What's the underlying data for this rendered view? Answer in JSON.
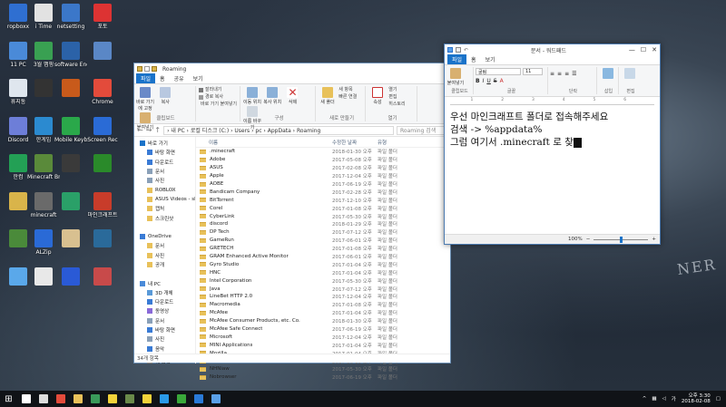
{
  "desktop": {
    "icons": [
      {
        "label": "ropboxx",
        "color": "#2f6fd1"
      },
      {
        "label": "i Time",
        "color": "#e2e2e2"
      },
      {
        "label": "netsetting",
        "color": "#3b77c9"
      },
      {
        "label": "포토",
        "color": "#d33"
      },
      {
        "label": "11 PC",
        "color": "#4a8ad8"
      },
      {
        "label": "3월 맵핑",
        "color": "#39a052"
      },
      {
        "label": "software Engine",
        "color": "#2b62a8"
      },
      {
        "label": "",
        "color": "#5a87c6"
      },
      {
        "label": "휴지통",
        "color": "#dfe6ee"
      },
      {
        "label": "",
        "color": "#333"
      },
      {
        "label": "",
        "color": "#c85a1b"
      },
      {
        "label": "Chrome",
        "color": "#e34b3b"
      },
      {
        "label": "Discord",
        "color": "#6d7ed8"
      },
      {
        "label": "한게임",
        "color": "#2b8ad0"
      },
      {
        "label": "Mobile Keyboard",
        "color": "#2aa84a"
      },
      {
        "label": "Screen Rec",
        "color": "#2a6bd6"
      },
      {
        "label": "한컴",
        "color": "#23a055"
      },
      {
        "label": "Minecraft Broadcaster",
        "color": "#5a8a3a"
      },
      {
        "label": "",
        "color": "#3a3a3a"
      },
      {
        "label": "",
        "color": "#2a8a2a"
      },
      {
        "label": "",
        "color": "#d9b44a"
      },
      {
        "label": "minecraft",
        "color": "#6a6a6a"
      },
      {
        "label": "",
        "color": "#2aa068"
      },
      {
        "label": "마인크래프트",
        "color": "#c83c2a"
      },
      {
        "label": "",
        "color": "#4a8a3a"
      },
      {
        "label": "ALZip",
        "color": "#2a6ad6"
      },
      {
        "label": "",
        "color": "#d8c090"
      },
      {
        "label": "",
        "color": "#2a6a9a"
      },
      {
        "label": "",
        "color": "#5aa8ea"
      },
      {
        "label": "",
        "color": "#e8e8e8"
      },
      {
        "label": "",
        "color": "#2a5ad6"
      },
      {
        "label": "",
        "color": "#c84a4a"
      }
    ],
    "wallpaper_text": "NER"
  },
  "explorer": {
    "title": "Roaming",
    "tabs": [
      "파일",
      "홈",
      "공유",
      "보기"
    ],
    "ribbon": {
      "clipboard": {
        "name": "클립보드",
        "pin": "바로 가기에 고정",
        "copy": "복사",
        "paste": "붙여넣기",
        "cut": "잘라내기",
        "copy_path": "경로 복사",
        "paste_shortcut": "바로 가기 붙여넣기"
      },
      "organize": {
        "name": "구성",
        "move": "이동 위치",
        "copy_to": "복사 위치",
        "delete": "삭제",
        "rename": "이름 바꾸기"
      },
      "new": {
        "name": "새로 만들기",
        "new_folder": "새 폴더",
        "new_item": "새 항목",
        "easy_access": "빠른 연결"
      },
      "open": {
        "name": "열기",
        "properties": "속성",
        "open": "열기",
        "edit": "편집",
        "history": "히스토리"
      },
      "select": {
        "name": "선택",
        "all": "모두 선택",
        "none": "선택 안 함",
        "invert": "선택 영역 반전"
      }
    },
    "address": "› 내 PC › 로컬 디스크 (C:) › Users › pc › AppData › Roaming",
    "search_placeholder": "Roaming 검색",
    "columns": {
      "name": "이름",
      "date": "수정한 날짜",
      "type": "유형"
    },
    "nav": [
      {
        "label": "바로 가기",
        "level": "top",
        "color": "#1a73c9"
      },
      {
        "label": "바탕 화면",
        "level": "sub",
        "color": "#3a7bd5"
      },
      {
        "label": "다운로드",
        "level": "sub",
        "color": "#3a7bd5"
      },
      {
        "label": "문서",
        "level": "sub",
        "color": "#8aa0b8"
      },
      {
        "label": "사진",
        "level": "sub",
        "color": "#8aa0b8"
      },
      {
        "label": "ROBLOX",
        "level": "sub",
        "color": "#e8c15a"
      },
      {
        "label": "ASUS Videos - share",
        "level": "sub",
        "color": "#e8c15a"
      },
      {
        "label": "캡처",
        "level": "sub",
        "color": "#e8c15a"
      },
      {
        "label": "스크린샷",
        "level": "sub",
        "color": "#e8c15a"
      },
      {
        "label": "",
        "level": "top",
        "color": "#fff"
      },
      {
        "label": "OneDrive",
        "level": "top",
        "color": "#3a7bd5"
      },
      {
        "label": "문서",
        "level": "sub",
        "color": "#e8c15a"
      },
      {
        "label": "사진",
        "level": "sub",
        "color": "#e8c15a"
      },
      {
        "label": "공개",
        "level": "sub",
        "color": "#e8c15a"
      },
      {
        "label": "",
        "level": "top",
        "color": "#fff"
      },
      {
        "label": "내 PC",
        "level": "top",
        "color": "#4a8ad8"
      },
      {
        "label": "3D 개체",
        "level": "sub",
        "color": "#5a9ad8"
      },
      {
        "label": "다운로드",
        "level": "sub",
        "color": "#3a7bd5"
      },
      {
        "label": "동영상",
        "level": "sub",
        "color": "#8a6ad8"
      },
      {
        "label": "문서",
        "level": "sub",
        "color": "#8aa0b8"
      },
      {
        "label": "바탕 화면",
        "level": "sub",
        "color": "#3a7bd5"
      },
      {
        "label": "사진",
        "level": "sub",
        "color": "#8aa0b8"
      },
      {
        "label": "음악",
        "level": "sub",
        "color": "#3a7bd5"
      },
      {
        "label": "로컬 디스크 (C:)",
        "level": "sub",
        "color": "#888",
        "selected": true
      },
      {
        "label": "새 볼륨 (D:)",
        "level": "sub",
        "color": "#888"
      },
      {
        "label": "",
        "level": "top",
        "color": "#fff"
      },
      {
        "label": "네트워크",
        "level": "top",
        "color": "#3a7bd5"
      }
    ],
    "files": [
      {
        "name": ".minecraft",
        "date": "2018-01-30 오후",
        "type": "파일 폴더"
      },
      {
        "name": "Adobe",
        "date": "2017-05-08 오후",
        "type": "파일 폴더"
      },
      {
        "name": "ASUS",
        "date": "2017-02-08 오후",
        "type": "파일 폴더"
      },
      {
        "name": "Apple",
        "date": "2017-12-04 오후",
        "type": "파일 폴더"
      },
      {
        "name": "AOBE",
        "date": "2017-06-19 오후",
        "type": "파일 폴더"
      },
      {
        "name": "Bandicam Company",
        "date": "2017-02-28 오후",
        "type": "파일 폴더"
      },
      {
        "name": "BitTorrent",
        "date": "2017-12-10 오후",
        "type": "파일 폴더"
      },
      {
        "name": "Corel",
        "date": "2017-01-08 오후",
        "type": "파일 폴더"
      },
      {
        "name": "CyberLink",
        "date": "2017-05-30 오후",
        "type": "파일 폴더"
      },
      {
        "name": "discord",
        "date": "2018-01-29 오후",
        "type": "파일 폴더"
      },
      {
        "name": "DP Tech",
        "date": "2017-07-12 오후",
        "type": "파일 폴더"
      },
      {
        "name": "GameRun",
        "date": "2017-06-01 오후",
        "type": "파일 폴더"
      },
      {
        "name": "GRETECH",
        "date": "2017-01-08 오후",
        "type": "파일 폴더"
      },
      {
        "name": "GRAM Enhanced Active Monitor",
        "date": "2017-06-01 오후",
        "type": "파일 폴더"
      },
      {
        "name": "Gyro Studio",
        "date": "2017-01-04 오후",
        "type": "파일 폴더"
      },
      {
        "name": "HNC",
        "date": "2017-01-04 오후",
        "type": "파일 폴더"
      },
      {
        "name": "Intel Corporation",
        "date": "2017-05-30 오후",
        "type": "파일 폴더"
      },
      {
        "name": "Java",
        "date": "2017-07-12 오후",
        "type": "파일 폴더"
      },
      {
        "name": "LineBet HTTP 2.0",
        "date": "2017-12-04 오후",
        "type": "파일 폴더"
      },
      {
        "name": "Macromedia",
        "date": "2017-01-08 오후",
        "type": "파일 폴더"
      },
      {
        "name": "McAfee",
        "date": "2017-01-04 오후",
        "type": "파일 폴더"
      },
      {
        "name": "McAfee Consumer Products, etc. Co.",
        "date": "2018-01-30 오후",
        "type": "파일 폴더"
      },
      {
        "name": "McAfee Safe Connect",
        "date": "2017-06-19 오후",
        "type": "파일 폴더"
      },
      {
        "name": "Microsoft",
        "date": "2017-12-04 오후",
        "type": "파일 폴더"
      },
      {
        "name": "MINI Applications",
        "date": "2017-01-04 오후",
        "type": "파일 폴더"
      },
      {
        "name": "Mozilla",
        "date": "2017-01-04 오후",
        "type": "파일 폴더"
      },
      {
        "name": "NCSoft",
        "date": "2017-06-19 오후",
        "type": "파일 폴더"
      },
      {
        "name": "NHNiaw",
        "date": "2017-05-30 오후",
        "type": "파일 폴더"
      },
      {
        "name": "Nobrowser",
        "date": "2017-06-19 오후",
        "type": "파일 폴더"
      }
    ],
    "status": "34개 항목"
  },
  "wordpad": {
    "title": "문서 - 워드패드",
    "tabs": [
      "파일",
      "홈",
      "보기"
    ],
    "font_name": "굴림",
    "font_size": "11",
    "clipboard_label": "클립보드",
    "font_label": "글꼴",
    "paragraph_label": "단락",
    "insert_label": "삽입",
    "edit_label": "편집",
    "paste_label": "붙여넣기",
    "lines": [
      "우선 마인크래프트 폴더로 접속해주세요",
      "검색 -> %appdata%",
      "그럼 여기서 .minecraft 로 찾"
    ],
    "zoom": "100%",
    "zoom_fraction": 0.5
  },
  "taskbar": {
    "apps": [
      {
        "name": "search",
        "color": "#fff"
      },
      {
        "name": "task-view",
        "color": "#ddd"
      },
      {
        "name": "chrome",
        "color": "#e34b3b"
      },
      {
        "name": "explorer",
        "color": "#e8c15a"
      },
      {
        "name": "hancom",
        "color": "#3a9a5a"
      },
      {
        "name": "kakao",
        "color": "#f3d33a"
      },
      {
        "name": "minecraft",
        "color": "#6a8a4a"
      },
      {
        "name": "kakaotalk",
        "color": "#f3d33a"
      },
      {
        "name": "skype",
        "color": "#2a9ae8"
      },
      {
        "name": "game",
        "color": "#3aa83a"
      },
      {
        "name": "store",
        "color": "#2a7ad8"
      },
      {
        "name": "wordpad",
        "color": "#5aa0e8"
      }
    ],
    "time": "오후 3:30",
    "date": "2018-02-08",
    "lang": "가"
  }
}
